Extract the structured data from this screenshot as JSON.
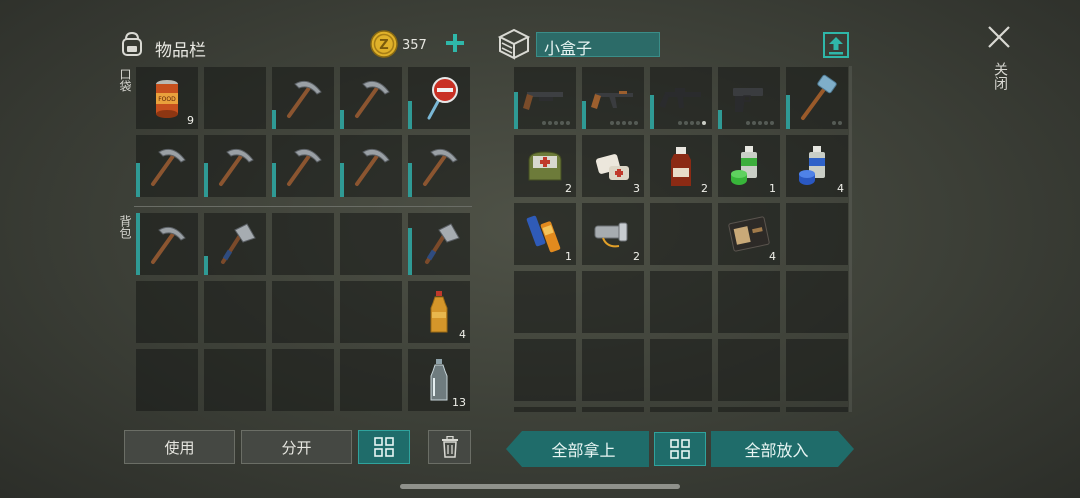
{
  "inventory": {
    "title": "物品栏",
    "coins": "357",
    "pocket_label": "口袋",
    "backpack_label": "背包",
    "pocket": [
      {
        "icon": "canned-food-icon",
        "count": "9",
        "dur": 0
      },
      {
        "icon": "empty",
        "count": "",
        "dur": 0
      },
      {
        "icon": "pickaxe-icon",
        "count": "",
        "dur": 0.3
      },
      {
        "icon": "pickaxe-icon",
        "count": "",
        "dur": 0.3
      },
      {
        "icon": "stop-sign-icon",
        "count": "",
        "dur": 0.45
      },
      {
        "icon": "pickaxe-icon",
        "count": "",
        "dur": 0.55
      },
      {
        "icon": "pickaxe-icon",
        "count": "",
        "dur": 0.55
      },
      {
        "icon": "pickaxe-icon",
        "count": "",
        "dur": 0.55
      },
      {
        "icon": "pickaxe-icon",
        "count": "",
        "dur": 0.55
      },
      {
        "icon": "pickaxe-icon",
        "count": "",
        "dur": 0.55
      }
    ],
    "backpack": [
      {
        "icon": "pickaxe-icon",
        "count": "",
        "dur": 1
      },
      {
        "icon": "hatchet-icon",
        "count": "",
        "dur": 0.3
      },
      {
        "icon": "empty",
        "count": "",
        "dur": 0
      },
      {
        "icon": "empty",
        "count": "",
        "dur": 0
      },
      {
        "icon": "hatchet-icon",
        "count": "",
        "dur": 0.75
      },
      {
        "icon": "empty",
        "count": "",
        "dur": 0
      },
      {
        "icon": "empty",
        "count": "",
        "dur": 0
      },
      {
        "icon": "empty",
        "count": "",
        "dur": 0
      },
      {
        "icon": "empty",
        "count": "",
        "dur": 0
      },
      {
        "icon": "water-bottle-full-icon",
        "count": "4",
        "dur": 0
      },
      {
        "icon": "empty",
        "count": "",
        "dur": 0
      },
      {
        "icon": "empty",
        "count": "",
        "dur": 0
      },
      {
        "icon": "empty",
        "count": "",
        "dur": 0
      },
      {
        "icon": "empty",
        "count": "",
        "dur": 0
      },
      {
        "icon": "water-bottle-empty-icon",
        "count": "13",
        "dur": 0
      }
    ],
    "use_label": "使用",
    "split_label": "分开"
  },
  "container": {
    "name": "小盒子",
    "items": [
      {
        "icon": "shotgun-icon",
        "count": "",
        "dur": 0.6,
        "ammo": [
          0,
          0,
          0,
          0,
          0
        ]
      },
      {
        "icon": "ak-rifle-icon",
        "count": "",
        "dur": 0.45,
        "ammo": [
          0,
          0,
          0,
          0,
          0
        ]
      },
      {
        "icon": "m16-rifle-icon",
        "count": "",
        "dur": 0.55,
        "ammo": [
          0,
          0,
          0,
          0,
          1
        ]
      },
      {
        "icon": "pistol-icon",
        "count": "",
        "dur": 0.3,
        "ammo": [
          0,
          0,
          0,
          0,
          0
        ]
      },
      {
        "icon": "sledgehammer-icon",
        "count": "",
        "dur": 0.55,
        "ammo": [
          0,
          0
        ]
      },
      {
        "icon": "first-aid-pouch-icon",
        "count": "2",
        "dur": 0
      },
      {
        "icon": "bandage-icon",
        "count": "3",
        "dur": 0
      },
      {
        "icon": "medicine-bottle-icon",
        "count": "2",
        "dur": 0
      },
      {
        "icon": "spray-paint-green-icon",
        "count": "1",
        "dur": 0
      },
      {
        "icon": "spray-paint-blue-icon",
        "count": "4",
        "dur": 0
      },
      {
        "icon": "batteries-icon",
        "count": "1",
        "dur": 0
      },
      {
        "icon": "flashlight-icon",
        "count": "2",
        "dur": 0
      },
      {
        "icon": "empty",
        "count": "",
        "dur": 0
      },
      {
        "icon": "wallet-icon",
        "count": "4",
        "dur": 0
      },
      {
        "icon": "empty",
        "count": "",
        "dur": 0
      }
    ],
    "take_all_label": "全部拿上",
    "put_all_label": "全部放入"
  },
  "close_label": "关闭",
  "colors": {
    "accent": "#2fa39d",
    "accent_dark": "#1f6c6a",
    "coin": "#e0b12a",
    "plus": "#2fb7a9"
  }
}
